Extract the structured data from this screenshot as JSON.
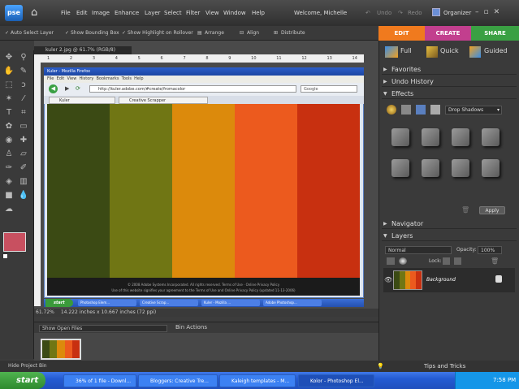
{
  "app": {
    "logo": "pse",
    "menu": [
      "File",
      "Edit",
      "Image",
      "Enhance",
      "Layer",
      "Select",
      "Filter",
      "View",
      "Window",
      "Help"
    ],
    "welcome": "Welcome, Michelle",
    "undo": "Undo",
    "redo": "Redo",
    "organizer": "Organizer"
  },
  "options_bar": {
    "auto_select": "Auto Select Layer",
    "show_bounding": "Show Bounding Box",
    "show_highlight": "Show Highlight on Rollover",
    "arrange": "Arrange",
    "align": "Align",
    "distribute": "Distribute"
  },
  "mode_tabs": {
    "edit": "EDIT",
    "create": "CREATE",
    "share": "SHARE"
  },
  "document": {
    "tab_label": "kuler 2.jpg @ 61.7% (RGB/8)",
    "ruler_ticks": [
      "1",
      "2",
      "3",
      "4",
      "5",
      "6",
      "7",
      "8",
      "9",
      "10",
      "11",
      "12",
      "13",
      "14"
    ],
    "zoom": "61.72%",
    "size": "14.222 inches x 10.667 inches (72 ppi)"
  },
  "browser": {
    "title": "Kuler - Mozilla Firefox",
    "menu": [
      "File",
      "Edit",
      "View",
      "History",
      "Bookmarks",
      "Tools",
      "Help"
    ],
    "url": "http://kuler.adobe.com/#create/fromacolor",
    "search": "Google",
    "tabs": [
      "Kuler",
      "Creative Scrapper"
    ],
    "footer_line1": "© 2008 Adobe Systems Incorporated. All rights reserved. Terms of Use · Online Privacy Policy",
    "footer_line2": "Use of this website signifies your agreement to the Terms of Use and Online Privacy Policy (updated 11-13-2006)",
    "mini_start": "start",
    "mini_tasks": [
      "Photoshop Elem...",
      "Creative Scrap...",
      "Kuler - Mozilla ...",
      "Adobe Photoshop..."
    ]
  },
  "palette": [
    "#3b4a14",
    "#707614",
    "#dc8a0c",
    "#ec5a1e",
    "#c83010"
  ],
  "project_bin": {
    "show": "Show Open Files",
    "actions": "Bin Actions",
    "hide": "Hide Project Bin"
  },
  "panel": {
    "modes": [
      "Full",
      "Quick",
      "Guided"
    ],
    "favorites": "Favorites",
    "undo_history": "Undo History",
    "effects": "Effects",
    "effects_dropdown": "Drop Shadows",
    "apply": "Apply",
    "navigator": "Navigator",
    "layers": "Layers",
    "blend_mode": "Normal",
    "opacity_label": "Opacity:",
    "opacity_value": "100%",
    "lock_label": "Lock:",
    "layer_name": "Background",
    "tips": "Tips and Tricks"
  },
  "taskbar": {
    "start": "start",
    "tasks": [
      "36% of 1 file - Downl...",
      "Bloggers: Creative Tre...",
      "Kaleigh templates - M...",
      "Kolor - Photoshop El..."
    ],
    "time": "7:58 PM"
  }
}
